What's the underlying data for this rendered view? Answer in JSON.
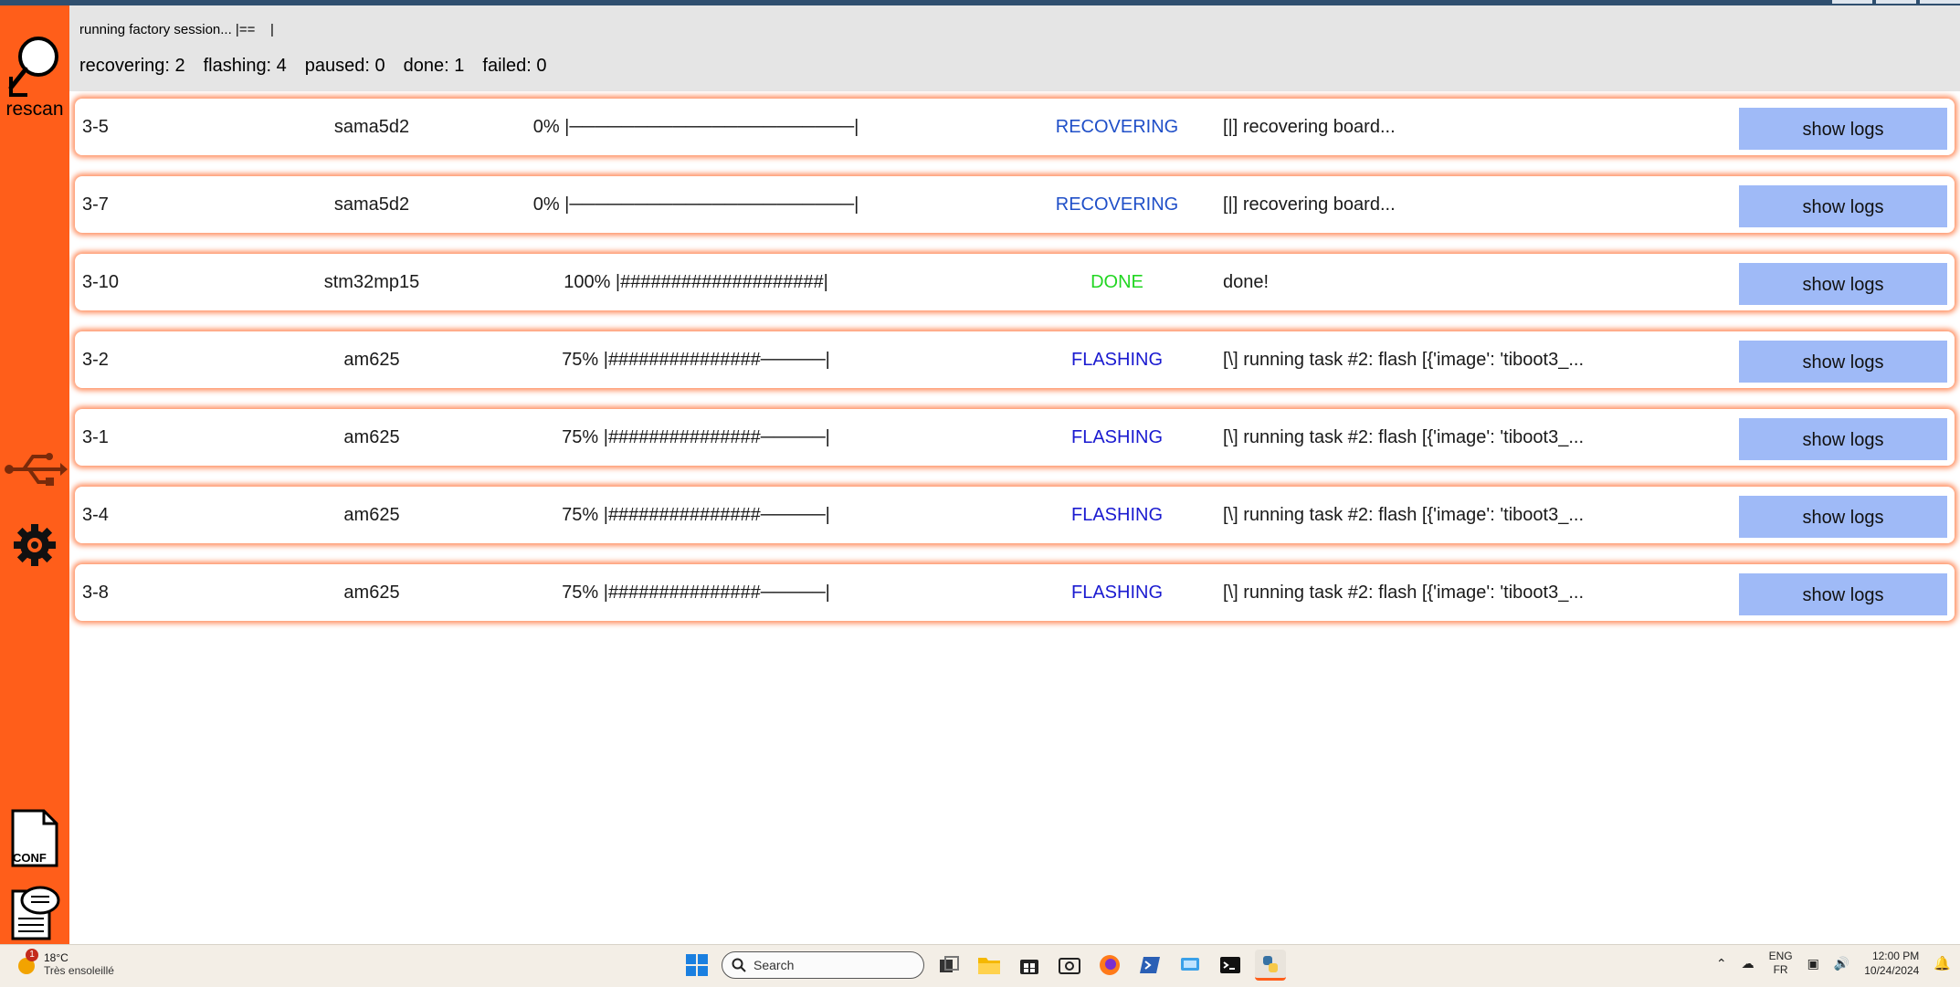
{
  "header": {
    "session_status": "running factory session... |==    |",
    "counters": [
      {
        "label": "recovering: 2"
      },
      {
        "label": "flashing: 4"
      },
      {
        "label": "paused: 0"
      },
      {
        "label": "done: 1"
      },
      {
        "label": "failed: 0"
      }
    ]
  },
  "sidebar": {
    "rescan_label": "rescan",
    "conf_label": "CONF",
    "accent_color": "#ff5e1a"
  },
  "boards": [
    {
      "port": "3-5",
      "soc": "sama5d2",
      "progress": 0,
      "progress_text": "0% |──────────────────────|",
      "state": "RECOVERING",
      "message": "[|] recovering board...",
      "button": "show logs"
    },
    {
      "port": "3-7",
      "soc": "sama5d2",
      "progress": 0,
      "progress_text": "0% |──────────────────────|",
      "state": "RECOVERING",
      "message": "[|] recovering board...",
      "button": "show logs"
    },
    {
      "port": "3-10",
      "soc": "stm32mp15",
      "progress": 100,
      "progress_text": "100% |####################|",
      "state": "DONE",
      "message": "done!",
      "button": "show logs"
    },
    {
      "port": "3-2",
      "soc": "am625",
      "progress": 75,
      "progress_text": "75% |###############─────|",
      "state": "FLASHING",
      "message": "[\\] running task #2: flash [{'image': 'tiboot3_...",
      "button": "show logs"
    },
    {
      "port": "3-1",
      "soc": "am625",
      "progress": 75,
      "progress_text": "75% |###############─────|",
      "state": "FLASHING",
      "message": "[\\] running task #2: flash [{'image': 'tiboot3_...",
      "button": "show logs"
    },
    {
      "port": "3-4",
      "soc": "am625",
      "progress": 75,
      "progress_text": "75% |###############─────|",
      "state": "FLASHING",
      "message": "[\\] running task #2: flash [{'image': 'tiboot3_...",
      "button": "show logs"
    },
    {
      "port": "3-8",
      "soc": "am625",
      "progress": 75,
      "progress_text": "75% |###############─────|",
      "state": "FLASHING",
      "message": "[\\] running task #2: flash [{'image': 'tiboot3_...",
      "button": "show logs"
    }
  ],
  "state_colors": {
    "RECOVERING": "#1f4fc8",
    "FLASHING": "#1a1ad0",
    "DONE": "#22d622"
  },
  "taskbar": {
    "weather_temp": "18°C",
    "weather_desc": "Très ensoleillé",
    "weather_badge": "1",
    "search_placeholder": "Search",
    "lang_top": "ENG",
    "lang_bottom": "FR",
    "time": "12:00 PM",
    "date": "10/24/2024",
    "apps": [
      "start-icon",
      "task-view-icon",
      "file-explorer-icon",
      "store-icon",
      "camera-app-icon",
      "firefox-icon",
      "powershell-icon",
      "remote-desktop-icon",
      "terminal-icon",
      "python-app-icon"
    ]
  }
}
